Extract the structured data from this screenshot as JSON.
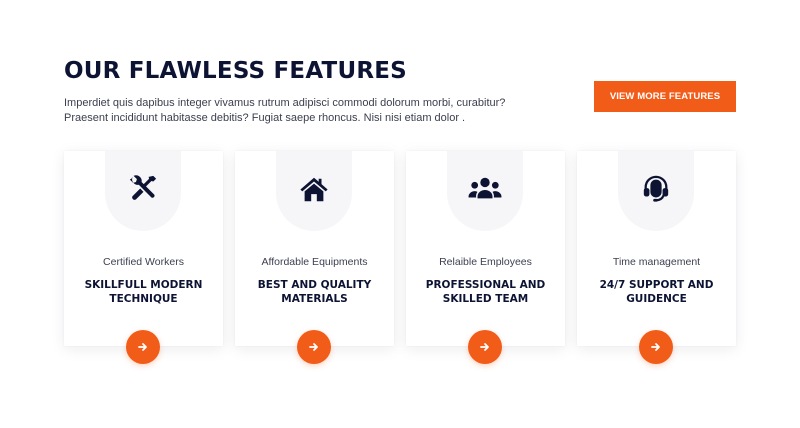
{
  "section": {
    "title": "OUR FLAWLESS FEATURES",
    "description": "Imperdiet quis dapibus integer vivamus rutrum adipisci commodi dolorum morbi, curabitur? Praesent incididunt habitasse debitis? Fugiat saepe rhoncus. Nisi nisi etiam dolor .",
    "cta_label": "VIEW MORE FEATURES"
  },
  "colors": {
    "accent": "#f25c19",
    "heading": "#0d1333",
    "icon_bg": "#f6f6f8"
  },
  "features": [
    {
      "icon": "tools-icon",
      "subtitle": "Certified Workers",
      "heading": "SKILLFULL MODERN TECHNIQUE"
    },
    {
      "icon": "home-icon",
      "subtitle": "Affordable Equipments",
      "heading": "BEST AND QUALITY MATERIALS"
    },
    {
      "icon": "team-icon",
      "subtitle": "Relaible Employees",
      "heading": "PROFESSIONAL AND SKILLED TEAM"
    },
    {
      "icon": "headset-icon",
      "subtitle": "Time management",
      "heading": "24/7 SUPPORT AND GUIDENCE"
    }
  ]
}
